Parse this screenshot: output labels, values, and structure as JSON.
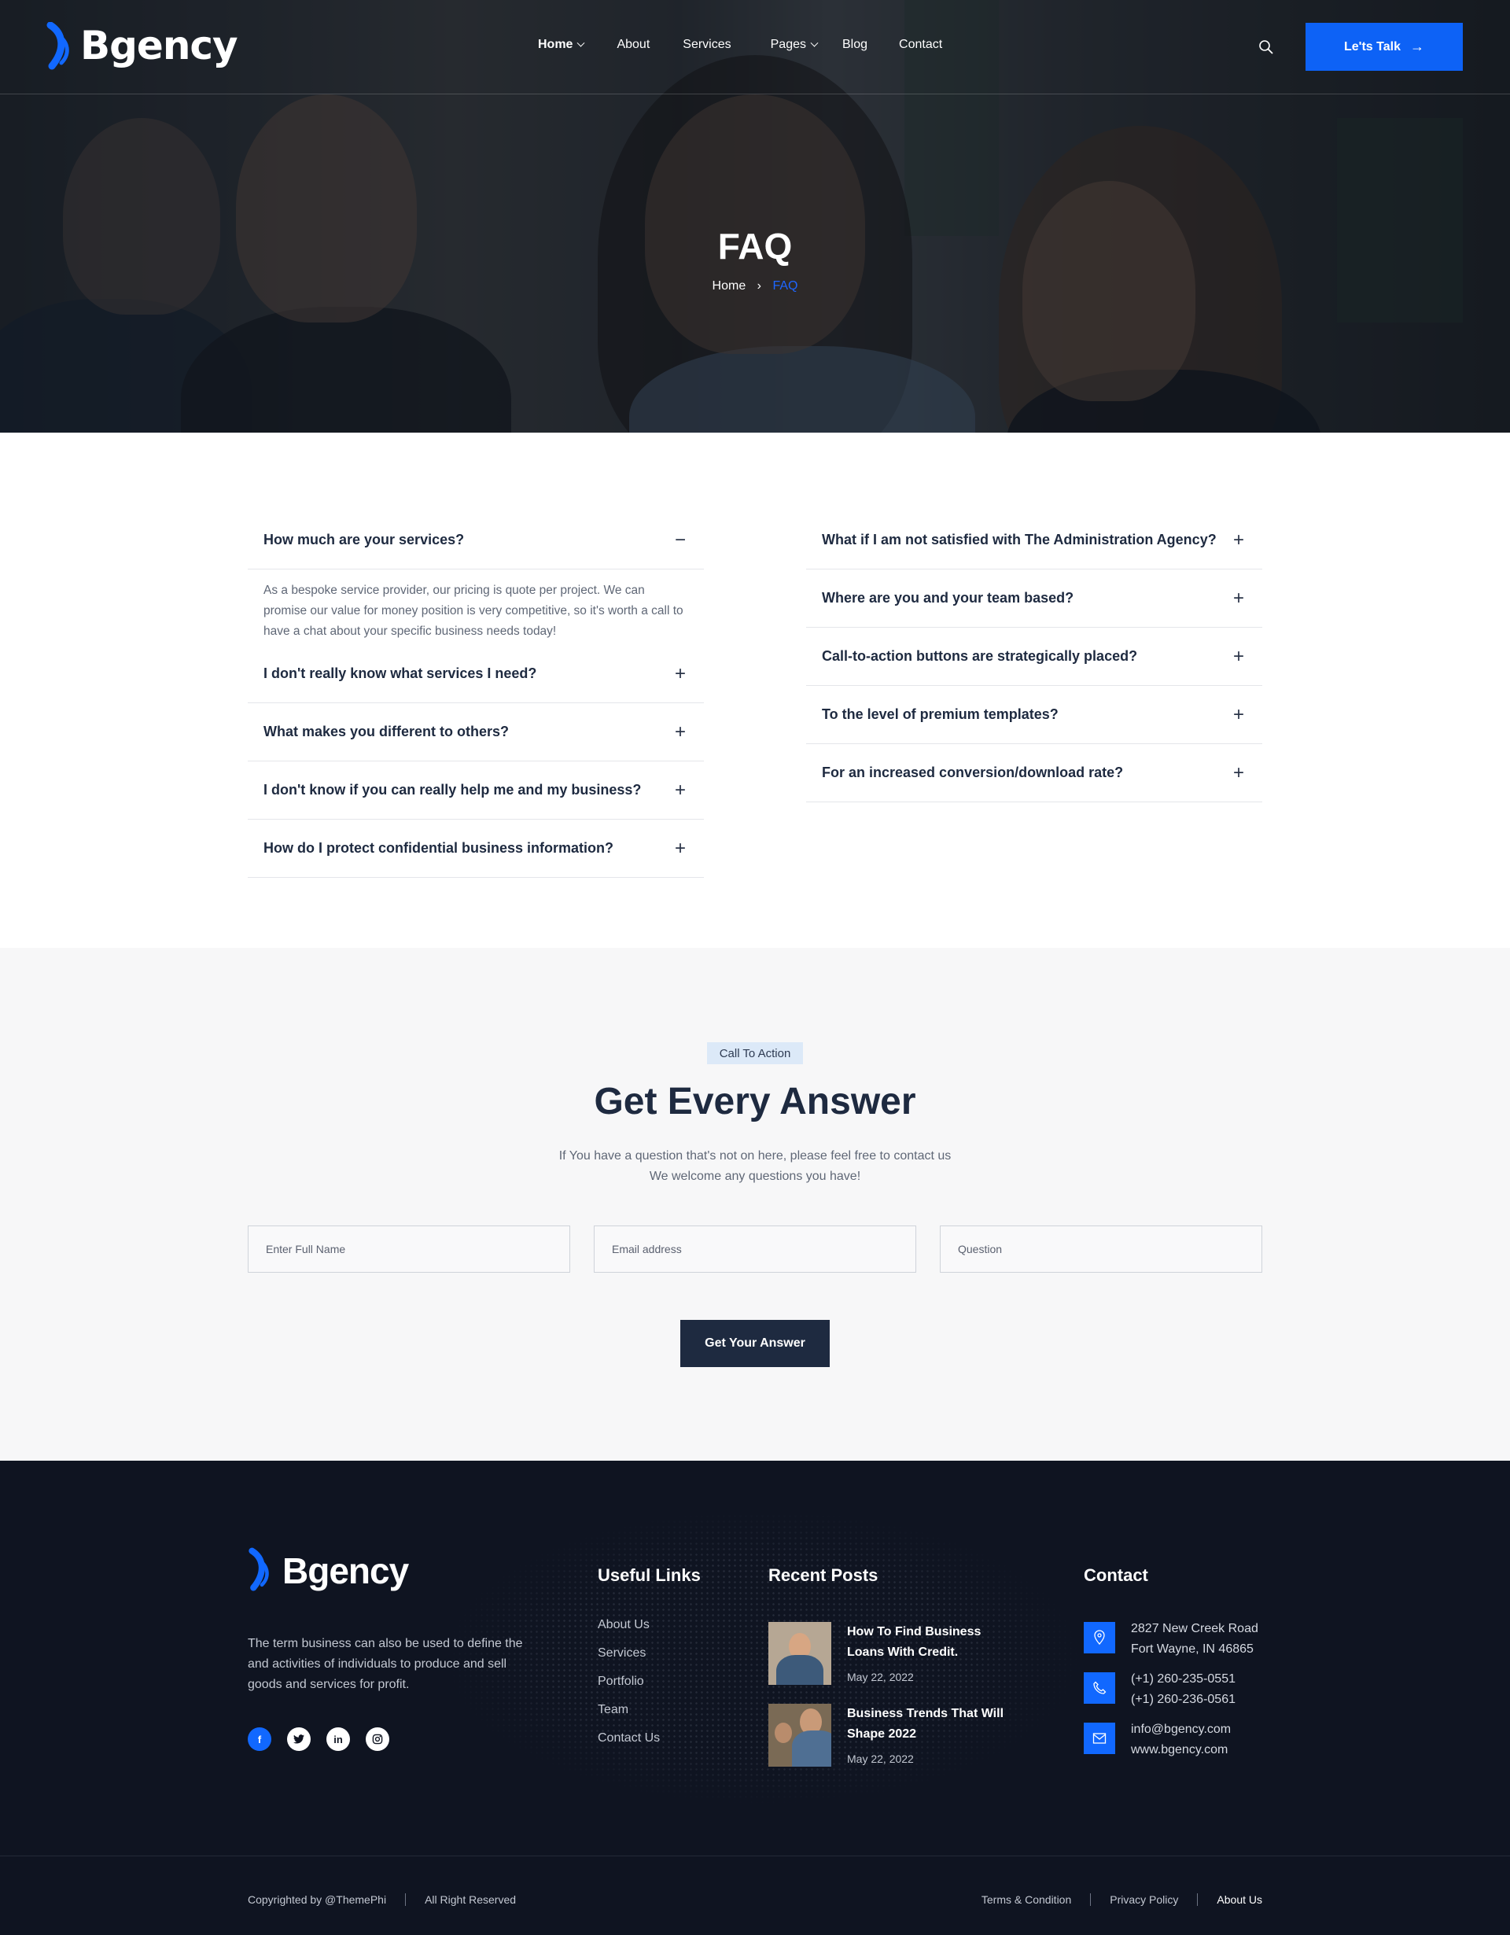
{
  "brand": {
    "name": "Bgency",
    "accent": "#0d62f6",
    "dark": "#1e2a40",
    "footer_bg": "#0f1421"
  },
  "nav": {
    "items": [
      {
        "label": "Home",
        "has_dropdown": true,
        "active": true
      },
      {
        "label": "About"
      },
      {
        "label": "Services"
      },
      {
        "label": "Pages",
        "has_dropdown": true
      },
      {
        "label": "Blog"
      },
      {
        "label": "Contact"
      }
    ],
    "cta_label": "Le'ts Talk"
  },
  "hero": {
    "title": "FAQ",
    "breadcrumb": {
      "home": "Home",
      "current": "FAQ"
    }
  },
  "faq": {
    "left": [
      {
        "q": "How much are your services?",
        "open": true,
        "a": "As a bespoke service provider, our pricing is quote per project. We can promise our value for money position is very competitive, so it's worth a call to have a chat about your specific business needs today!"
      },
      {
        "q": "I don't really know what services I need?"
      },
      {
        "q": "What makes you different to others?"
      },
      {
        "q": "I don't know if you can really help me and my business?"
      },
      {
        "q": "How do I protect confidential business information?"
      }
    ],
    "right": [
      {
        "q": "What if I am not satisfied with The Administration Agency?"
      },
      {
        "q": "Where are you and your team based?"
      },
      {
        "q": "Call-to-action buttons are strategically placed?"
      },
      {
        "q": "To the level of premium templates?"
      },
      {
        "q": "For an increased conversion/download rate?"
      }
    ]
  },
  "cta": {
    "tag": "Call To Action",
    "title": "Get Every Answer",
    "sub_line1": "If You have a question that's not on here, please feel free to contact us",
    "sub_line2": "We welcome any questions you have!",
    "fields": {
      "name_placeholder": "Enter Full Name",
      "email_placeholder": "Email address",
      "question_placeholder": "Question"
    },
    "submit_label": "Get Your Answer"
  },
  "footer": {
    "brand": "Bgency",
    "about": "The term business can also be used to define the and activities of individuals to produce and sell goods and services for profit.",
    "socials": [
      "facebook-icon",
      "twitter-icon",
      "linkedin-icon",
      "instagram-icon"
    ],
    "useful_links": {
      "heading": "Useful Links",
      "items": [
        "About Us",
        "Services",
        "Portfolio",
        "Team",
        "Contact Us"
      ]
    },
    "recent_posts": {
      "heading": "Recent Posts",
      "items": [
        {
          "title": "How To Find Business Loans With Credit.",
          "date": "May 22, 2022"
        },
        {
          "title": "Business Trends That Will Shape 2022",
          "date": "May 22, 2022"
        }
      ]
    },
    "contact": {
      "heading": "Contact",
      "address_line1": "2827 New Creek Road",
      "address_line2": "Fort Wayne, IN 46865",
      "phone1": "(+1) 260-235-0551",
      "phone2": "(+1) 260-236-0561",
      "email": "info@bgency.com",
      "web": "www.bgency.com"
    },
    "bottom": {
      "copyright": "Copyrighted by @ThemePhi",
      "rights": "All Right Reserved",
      "links": [
        "Terms & Condition",
        "Privacy Policy",
        "About Us"
      ]
    }
  }
}
